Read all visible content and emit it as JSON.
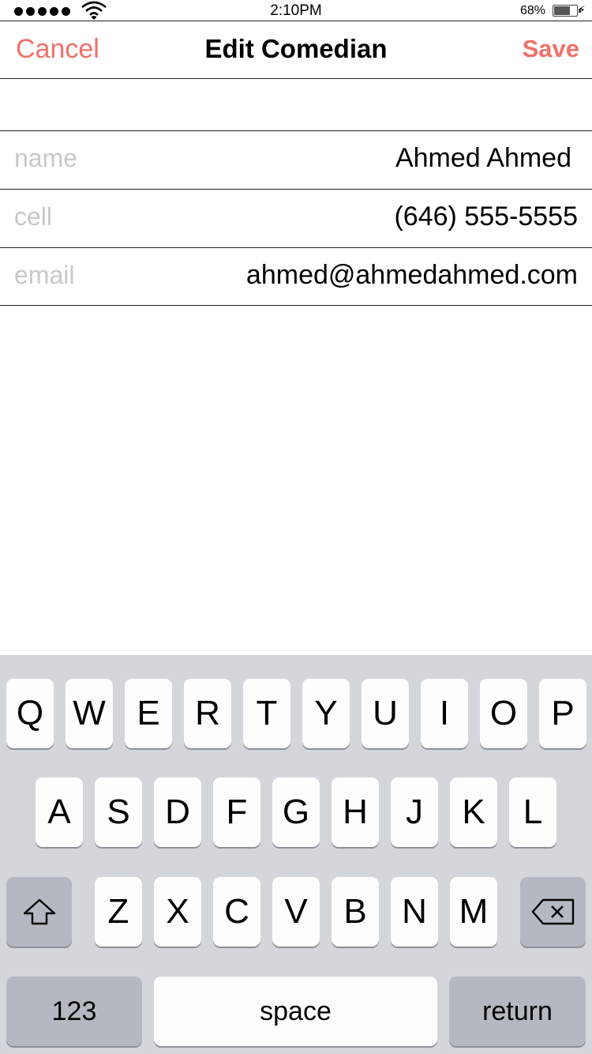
{
  "status_bar": {
    "time": "2:10PM",
    "battery_percent": "68%",
    "battery_level": 0.68,
    "signal_bars": 5,
    "icons": [
      "signal-dots",
      "wifi-icon",
      "battery-icon",
      "charging-bolt-icon"
    ]
  },
  "nav": {
    "cancel_label": "Cancel",
    "title": "Edit Comedian",
    "save_label": "Save",
    "accent_color": "#f0706a"
  },
  "form": {
    "fields": [
      {
        "label": "name",
        "value": "Ahmed Ahmed"
      },
      {
        "label": "cell",
        "value": "(646) 555-5555"
      },
      {
        "label": "email",
        "value": "ahmed@ahmedahmed.com"
      }
    ]
  },
  "keyboard": {
    "row1": [
      "Q",
      "W",
      "E",
      "R",
      "T",
      "Y",
      "U",
      "I",
      "O",
      "P"
    ],
    "row2": [
      "A",
      "S",
      "D",
      "F",
      "G",
      "H",
      "J",
      "K",
      "L"
    ],
    "row3": [
      "Z",
      "X",
      "C",
      "V",
      "B",
      "N",
      "M"
    ],
    "numbers_label": "123",
    "space_label": "space",
    "return_label": "return",
    "shift_icon": "shift-icon",
    "delete_icon": "backspace-icon"
  }
}
